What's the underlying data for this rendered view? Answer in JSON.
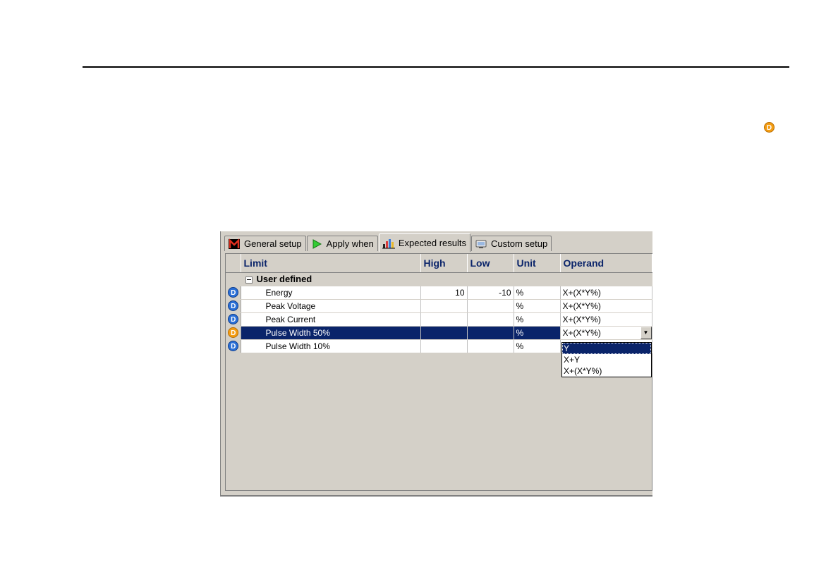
{
  "page_badge": "D",
  "tabs": [
    {
      "label": "General setup",
      "icon": "m-logo-icon"
    },
    {
      "label": "Apply when",
      "icon": "play-arrow-icon"
    },
    {
      "label": "Expected results",
      "icon": "bar-chart-icon",
      "active": true
    },
    {
      "label": "Custom setup",
      "icon": "monitor-icon"
    }
  ],
  "grid": {
    "columns": [
      "Limit",
      "High",
      "Low",
      "Unit",
      "Operand"
    ],
    "group_label": "User defined",
    "rows": [
      {
        "badge": "D",
        "badge_color": "#2a6fd6",
        "limit": "Energy",
        "high": "10",
        "low": "-10",
        "unit": "%",
        "operand": "X+(X*Y%)"
      },
      {
        "badge": "D",
        "badge_color": "#2a6fd6",
        "limit": "Peak Voltage",
        "high": "",
        "low": "",
        "unit": "%",
        "operand": "X+(X*Y%)"
      },
      {
        "badge": "D",
        "badge_color": "#2a6fd6",
        "limit": "Peak Current",
        "high": "",
        "low": "",
        "unit": "%",
        "operand": "X+(X*Y%)"
      },
      {
        "badge": "D",
        "badge_color": "#f39c12",
        "limit": "Pulse Width 50%",
        "high": "",
        "low": "",
        "unit": "%",
        "operand": "X+(X*Y%)",
        "selected": true
      },
      {
        "badge": "D",
        "badge_color": "#2a6fd6",
        "limit": "Pulse Width 10%",
        "high": "",
        "low": "",
        "unit": "%",
        "operand": ""
      }
    ]
  },
  "operand_dropdown": {
    "options": [
      "Y",
      "X+Y",
      "X+(X*Y%)"
    ],
    "highlighted": "Y"
  },
  "colors": {
    "selection": "#0a246a",
    "header_text": "#0a246a",
    "window_bg": "#d4d0c8"
  }
}
